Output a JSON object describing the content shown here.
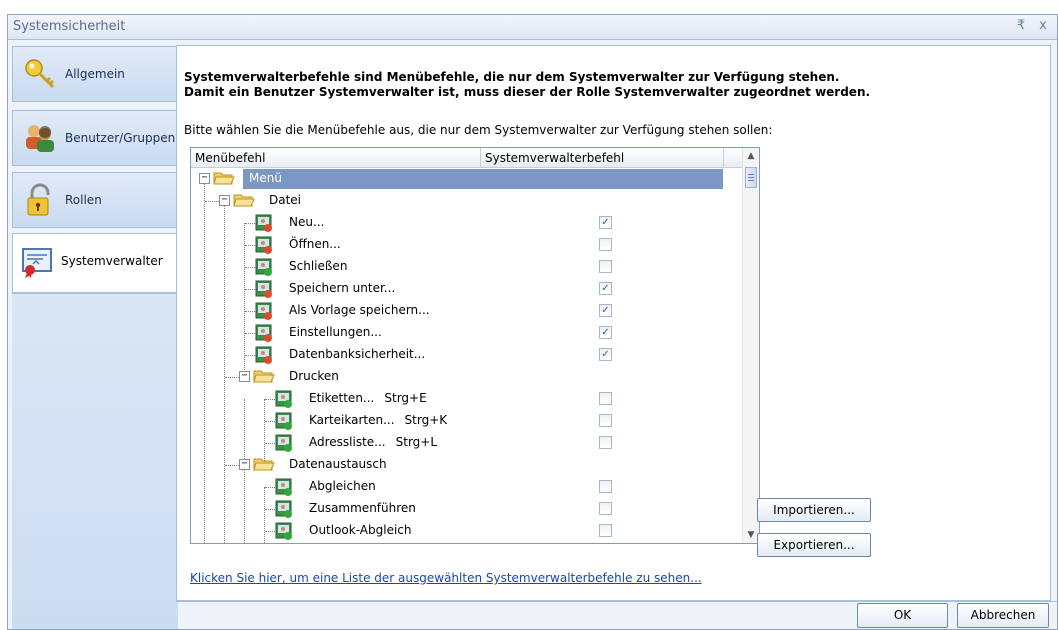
{
  "window": {
    "title": "Systemsicherheit",
    "pin_glyph": "₹",
    "close_glyph": "x"
  },
  "nav": {
    "items": [
      {
        "label": "Allgemein",
        "icon": "key-icon"
      },
      {
        "label": "Benutzer/Gruppen",
        "icon": "users-icon"
      },
      {
        "label": "Rollen",
        "icon": "padlock-icon"
      },
      {
        "label": "Systemverwalter",
        "icon": "certificate-icon"
      }
    ]
  },
  "main": {
    "header_line1": "Systemverwalterbefehle sind Menübefehle, die nur dem Systemverwalter zur Verfügung stehen.",
    "header_line2": "Damit ein Benutzer Systemverwalter ist, muss dieser der Rolle Systemverwalter zugeordnet werden.",
    "instruction": "Bitte wählen Sie die Menübefehle aus, die nur dem Systemverwalter zur Verfügung stehen sollen:",
    "columns": [
      "Menübefehl",
      "Systemverwalterbefehl"
    ],
    "rows": [
      {
        "label": "Menü",
        "type": "folder",
        "level": 0,
        "selected": true
      },
      {
        "label": "Datei",
        "type": "folder",
        "level": 1
      },
      {
        "label": "Neu...",
        "type": "item",
        "level": 2,
        "checked": true
      },
      {
        "label": "Öffnen...",
        "type": "item",
        "level": 2,
        "checked": false
      },
      {
        "label": "Schließen",
        "type": "item",
        "level": 2,
        "checked": false
      },
      {
        "label": "Speichern unter...",
        "type": "item",
        "level": 2,
        "checked": true
      },
      {
        "label": "Als Vorlage speichern...",
        "type": "item",
        "level": 2,
        "checked": true
      },
      {
        "label": "Einstellungen...",
        "type": "item",
        "level": 2,
        "checked": true
      },
      {
        "label": "Datenbanksicherheit...",
        "type": "item",
        "level": 2,
        "checked": true
      },
      {
        "label": "Drucken",
        "type": "folder",
        "level": 2
      },
      {
        "label": "Etiketten...",
        "shortcut": "Strg+E",
        "type": "item",
        "level": 3,
        "checked": false
      },
      {
        "label": "Karteikarten...",
        "shortcut": "Strg+K",
        "type": "item",
        "level": 3,
        "checked": false
      },
      {
        "label": "Adressliste...",
        "shortcut": "Strg+L",
        "type": "item",
        "level": 3,
        "checked": false
      },
      {
        "label": "Datenaustausch",
        "type": "folder",
        "level": 2
      },
      {
        "label": "Abgleichen",
        "type": "item",
        "level": 3,
        "checked": false
      },
      {
        "label": "Zusammenführen",
        "type": "item",
        "level": 3,
        "checked": false
      },
      {
        "label": "Outlook-Abgleich",
        "type": "item",
        "level": 3,
        "checked": false
      }
    ],
    "import_label": "Importieren...",
    "export_label": "Exportieren...",
    "link_text": "Klicken Sie hier, um eine Liste der ausgewählten Systemverwalterbefehle zu sehen..."
  },
  "footer": {
    "ok_label": "OK",
    "cancel_label": "Abbrechen"
  },
  "colors": {
    "selection": "#7b98c4",
    "link": "#1a47a8",
    "border": "#a9bfdd"
  }
}
